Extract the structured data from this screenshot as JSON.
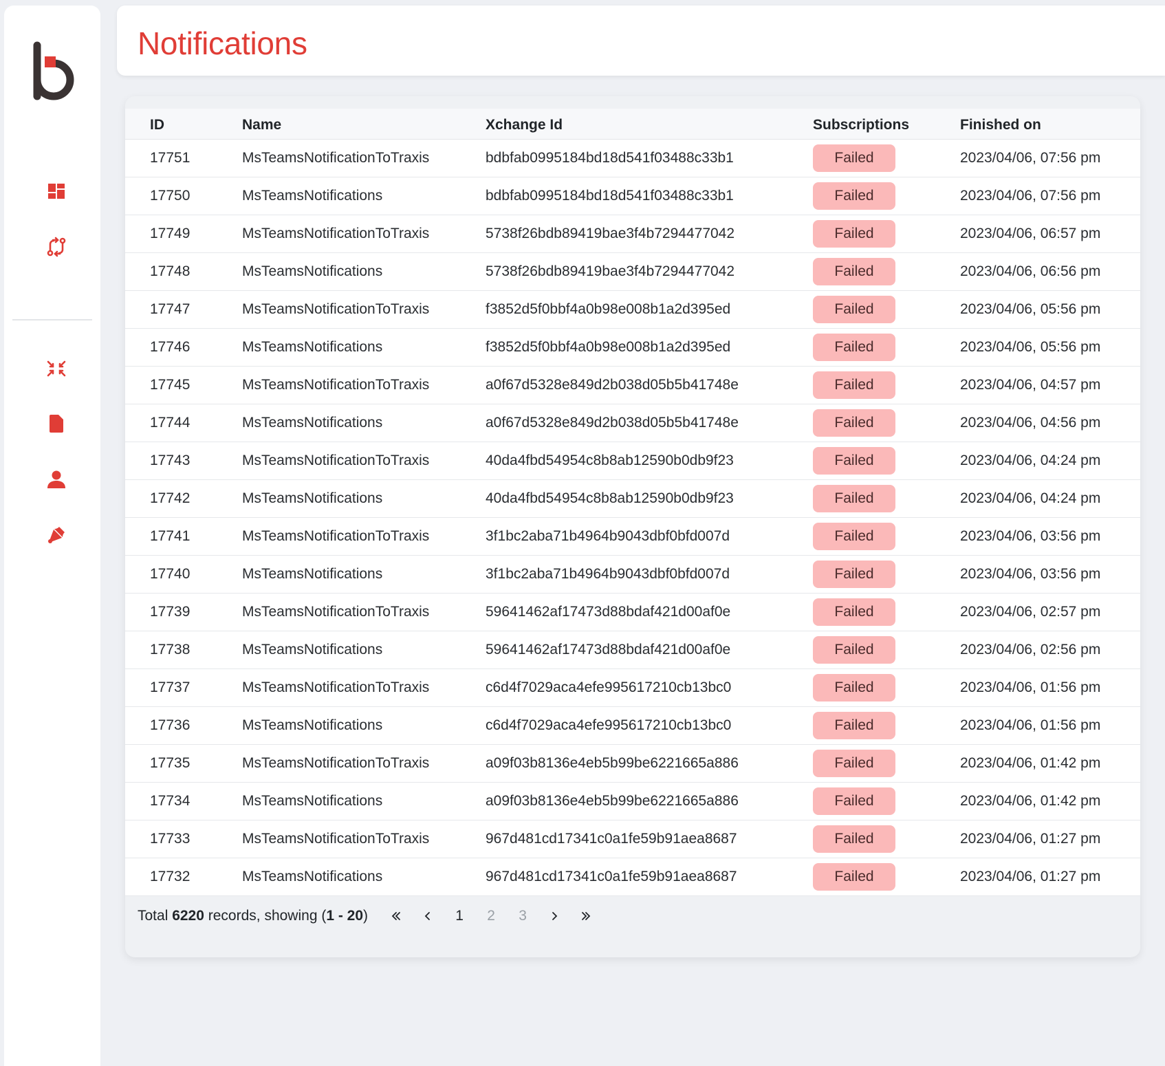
{
  "header": {
    "title": "Notifications"
  },
  "sidebar": {
    "logo": "b-logo",
    "items": [
      {
        "name": "dashboard-icon"
      },
      {
        "name": "sync-flow-icon"
      },
      {
        "name": "compress-arrows-icon"
      },
      {
        "name": "file-icon"
      },
      {
        "name": "user-icon"
      },
      {
        "name": "bell-icon"
      }
    ]
  },
  "colors": {
    "accent": "#e03d36",
    "badge_failed_bg": "#fbb9b9"
  },
  "table": {
    "headers": {
      "id": "ID",
      "name": "Name",
      "xchange_id": "Xchange Id",
      "subscriptions": "Subscriptions",
      "finished_on": "Finished on"
    },
    "rows": [
      {
        "id": "17751",
        "name": "MsTeamsNotificationToTraxis",
        "xchange_id": "bdbfab0995184bd18d541f03488c33b1",
        "status": "Failed",
        "finished": "2023/04/06, 07:56 pm"
      },
      {
        "id": "17750",
        "name": "MsTeamsNotifications",
        "xchange_id": "bdbfab0995184bd18d541f03488c33b1",
        "status": "Failed",
        "finished": "2023/04/06, 07:56 pm"
      },
      {
        "id": "17749",
        "name": "MsTeamsNotificationToTraxis",
        "xchange_id": "5738f26bdb89419bae3f4b7294477042",
        "status": "Failed",
        "finished": "2023/04/06, 06:57 pm"
      },
      {
        "id": "17748",
        "name": "MsTeamsNotifications",
        "xchange_id": "5738f26bdb89419bae3f4b7294477042",
        "status": "Failed",
        "finished": "2023/04/06, 06:56 pm"
      },
      {
        "id": "17747",
        "name": "MsTeamsNotificationToTraxis",
        "xchange_id": "f3852d5f0bbf4a0b98e008b1a2d395ed",
        "status": "Failed",
        "finished": "2023/04/06, 05:56 pm"
      },
      {
        "id": "17746",
        "name": "MsTeamsNotifications",
        "xchange_id": "f3852d5f0bbf4a0b98e008b1a2d395ed",
        "status": "Failed",
        "finished": "2023/04/06, 05:56 pm"
      },
      {
        "id": "17745",
        "name": "MsTeamsNotificationToTraxis",
        "xchange_id": "a0f67d5328e849d2b038d05b5b41748e",
        "status": "Failed",
        "finished": "2023/04/06, 04:57 pm"
      },
      {
        "id": "17744",
        "name": "MsTeamsNotifications",
        "xchange_id": "a0f67d5328e849d2b038d05b5b41748e",
        "status": "Failed",
        "finished": "2023/04/06, 04:56 pm"
      },
      {
        "id": "17743",
        "name": "MsTeamsNotificationToTraxis",
        "xchange_id": "40da4fbd54954c8b8ab12590b0db9f23",
        "status": "Failed",
        "finished": "2023/04/06, 04:24 pm"
      },
      {
        "id": "17742",
        "name": "MsTeamsNotifications",
        "xchange_id": "40da4fbd54954c8b8ab12590b0db9f23",
        "status": "Failed",
        "finished": "2023/04/06, 04:24 pm"
      },
      {
        "id": "17741",
        "name": "MsTeamsNotificationToTraxis",
        "xchange_id": "3f1bc2aba71b4964b9043dbf0bfd007d",
        "status": "Failed",
        "finished": "2023/04/06, 03:56 pm"
      },
      {
        "id": "17740",
        "name": "MsTeamsNotifications",
        "xchange_id": "3f1bc2aba71b4964b9043dbf0bfd007d",
        "status": "Failed",
        "finished": "2023/04/06, 03:56 pm"
      },
      {
        "id": "17739",
        "name": "MsTeamsNotificationToTraxis",
        "xchange_id": "59641462af17473d88bdaf421d00af0e",
        "status": "Failed",
        "finished": "2023/04/06, 02:57 pm"
      },
      {
        "id": "17738",
        "name": "MsTeamsNotifications",
        "xchange_id": "59641462af17473d88bdaf421d00af0e",
        "status": "Failed",
        "finished": "2023/04/06, 02:56 pm"
      },
      {
        "id": "17737",
        "name": "MsTeamsNotificationToTraxis",
        "xchange_id": "c6d4f7029aca4efe995617210cb13bc0",
        "status": "Failed",
        "finished": "2023/04/06, 01:56 pm"
      },
      {
        "id": "17736",
        "name": "MsTeamsNotifications",
        "xchange_id": "c6d4f7029aca4efe995617210cb13bc0",
        "status": "Failed",
        "finished": "2023/04/06, 01:56 pm"
      },
      {
        "id": "17735",
        "name": "MsTeamsNotificationToTraxis",
        "xchange_id": "a09f03b8136e4eb5b99be6221665a886",
        "status": "Failed",
        "finished": "2023/04/06, 01:42 pm"
      },
      {
        "id": "17734",
        "name": "MsTeamsNotifications",
        "xchange_id": "a09f03b8136e4eb5b99be6221665a886",
        "status": "Failed",
        "finished": "2023/04/06, 01:42 pm"
      },
      {
        "id": "17733",
        "name": "MsTeamsNotificationToTraxis",
        "xchange_id": "967d481cd17341c0a1fe59b91aea8687",
        "status": "Failed",
        "finished": "2023/04/06, 01:27 pm"
      },
      {
        "id": "17732",
        "name": "MsTeamsNotifications",
        "xchange_id": "967d481cd17341c0a1fe59b91aea8687",
        "status": "Failed",
        "finished": "2023/04/06, 01:27 pm"
      }
    ]
  },
  "footer": {
    "total_prefix": "Total ",
    "total_count": "6220",
    "total_mid": " records, showing (",
    "range": "1 - 20",
    "total_suffix": ")",
    "pages": [
      "1",
      "2",
      "3"
    ],
    "current_page": "1"
  }
}
